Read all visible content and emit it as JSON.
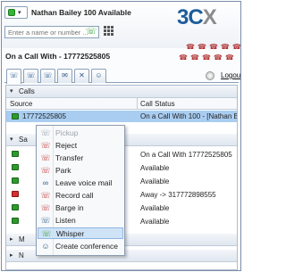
{
  "header": {
    "status_indicator": "green-status-icon",
    "user_name": "Nathan Bailey 100 Available",
    "logo_main": "3C",
    "logo_x": "X",
    "dial_placeholder": "Enter a name or number ...",
    "call_title": "On a Call With - 17772525805",
    "logout": "Logout"
  },
  "tabs": [
    "phone-tab",
    "missed-calls-tab",
    "queues-tab",
    "chat-tab",
    "settings-tab",
    "contacts-tab"
  ],
  "calls": {
    "section_label": "Calls",
    "col_source": "Source",
    "col_status": "Call Status",
    "active_call": {
      "source": "17772525805",
      "status": "On a Call With 100 - [Nathan Baile"
    }
  },
  "status_section_label": "Sa",
  "extensions": [
    {
      "status": "On a Call With 17772525805",
      "color": "green"
    },
    {
      "status": "Available",
      "color": "green"
    },
    {
      "status": "Available",
      "color": "green"
    },
    {
      "status": "Away -> 317772898555",
      "color": "red"
    },
    {
      "status": "Available",
      "color": "green"
    },
    {
      "status": "Available",
      "color": "green"
    }
  ],
  "collapsed_sections": [
    "M",
    "N"
  ],
  "context_menu": {
    "items": [
      {
        "label": "Pickup",
        "disabled": true,
        "icon": "pickup-icon"
      },
      {
        "label": "Reject",
        "disabled": false,
        "icon": "reject-icon"
      },
      {
        "label": "Transfer",
        "disabled": false,
        "icon": "transfer-icon"
      },
      {
        "label": "Park",
        "disabled": false,
        "icon": "park-icon"
      },
      {
        "label": "Leave voice mail",
        "disabled": false,
        "icon": "voicemail-icon"
      },
      {
        "label": "Record call",
        "disabled": false,
        "icon": "record-icon"
      },
      {
        "label": "Barge in",
        "disabled": false,
        "icon": "barge-in-icon"
      },
      {
        "label": "Listen",
        "disabled": false,
        "icon": "listen-icon"
      },
      {
        "label": "Whisper",
        "disabled": false,
        "highlighted": true,
        "icon": "whisper-icon"
      },
      {
        "label": "Create conference",
        "disabled": false,
        "icon": "conference-icon"
      }
    ]
  },
  "colors": {
    "accent": "#1c5c9c",
    "selected_row": "#a9cdf1",
    "available": "#2d9a2d",
    "away": "#d43030"
  }
}
